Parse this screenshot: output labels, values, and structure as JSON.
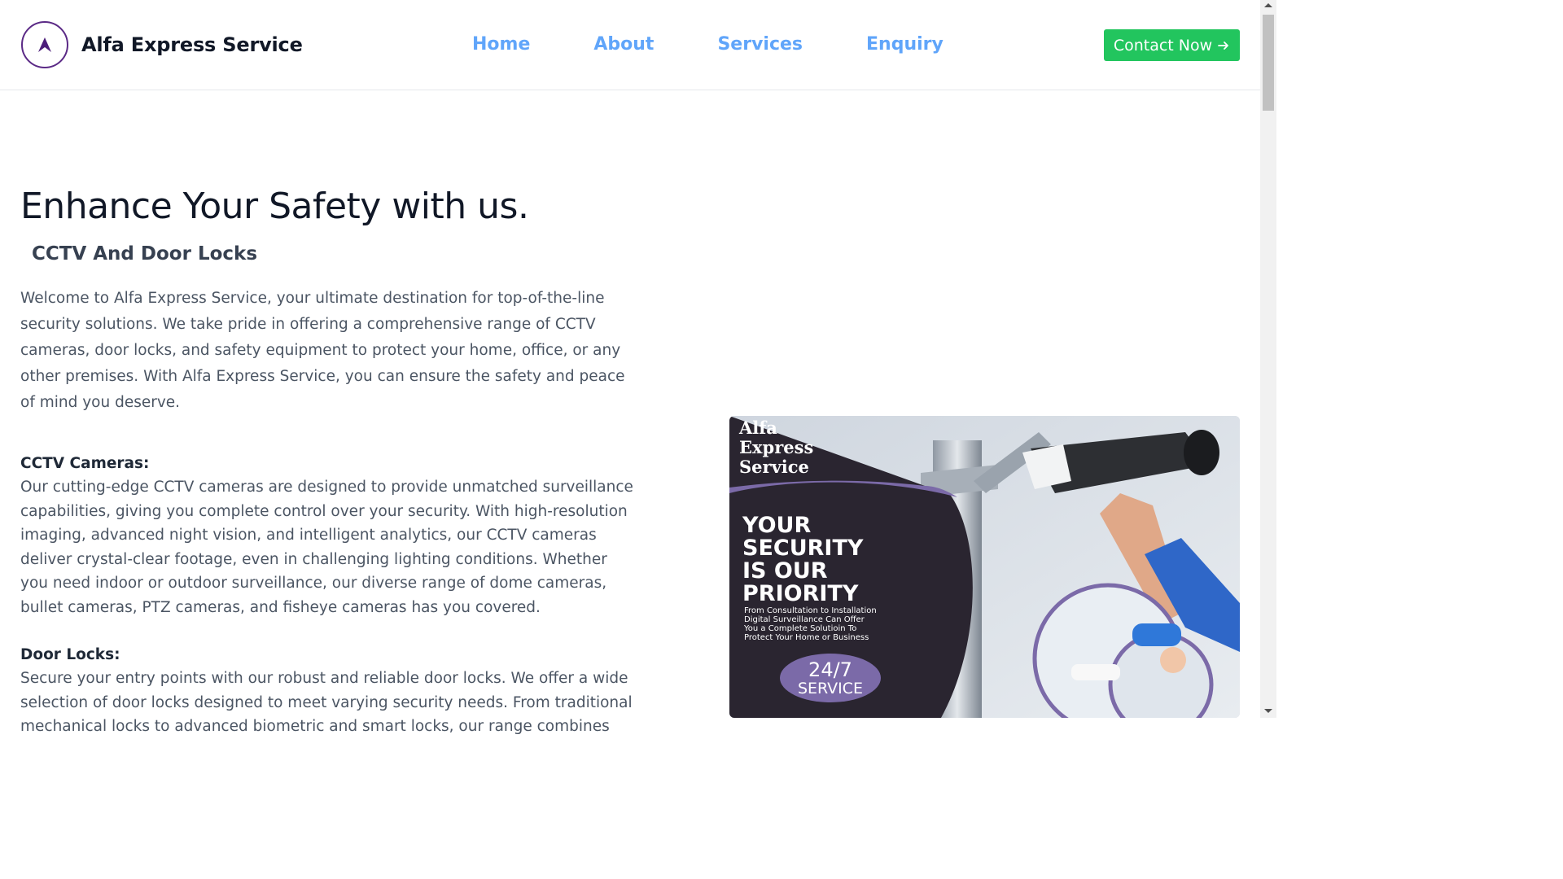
{
  "header": {
    "brand": "Alfa Express Service",
    "nav": [
      "Home",
      "About",
      "Services",
      "Enquiry"
    ],
    "cta_label": "Contact Now",
    "cta_icon": "arrow-right-icon",
    "logo_icon": "arrow-up-logo-icon",
    "logo_color": "#5b2a86",
    "nav_color": "#60a5fa",
    "cta_color": "#22c55e"
  },
  "hero": {
    "title": "Enhance Your Safety with us.",
    "subtitle": "CCTV And Door Locks",
    "intro": "Welcome to Alfa Express Service, your ultimate destination for top-of-the-line security solutions. We take pride in offering a comprehensive range of CCTV cameras, door locks, and safety equipment to protect your home, office, or any other premises. With Alfa Express Service, you can ensure the safety and peace of mind you deserve."
  },
  "sections": [
    {
      "title": "CCTV Cameras:",
      "body": "Our cutting-edge CCTV cameras are designed to provide unmatched surveillance capabilities, giving you complete control over your security. With high-resolution imaging, advanced night vision, and intelligent analytics, our CCTV cameras deliver crystal-clear footage, even in challenging lighting conditions. Whether you need indoor or outdoor surveillance, our diverse range of dome cameras, bullet cameras, PTZ cameras, and fisheye cameras has you covered."
    },
    {
      "title": "Door Locks:",
      "body": "Secure your entry points with our robust and reliable door locks. We offer a wide selection of door locks designed to meet varying security needs. From traditional mechanical locks to advanced biometric and smart locks, our range combines"
    }
  ],
  "promo": {
    "brand_lines": [
      "Alfa",
      "Express",
      "Service"
    ],
    "headline_lines": [
      "YOUR",
      "SECURITY",
      "IS OUR",
      "PRIORITY"
    ],
    "tagline_lines": [
      "From Consultation to Installation",
      "Digital Surveillance Can Offer",
      "You a Complete Solutioin To",
      "Protect Your Home or Business"
    ],
    "badge_top": "24/7",
    "badge_bottom": "SERVICE",
    "panel_color": "#2a2530",
    "accent_color": "#7b6aa8"
  }
}
